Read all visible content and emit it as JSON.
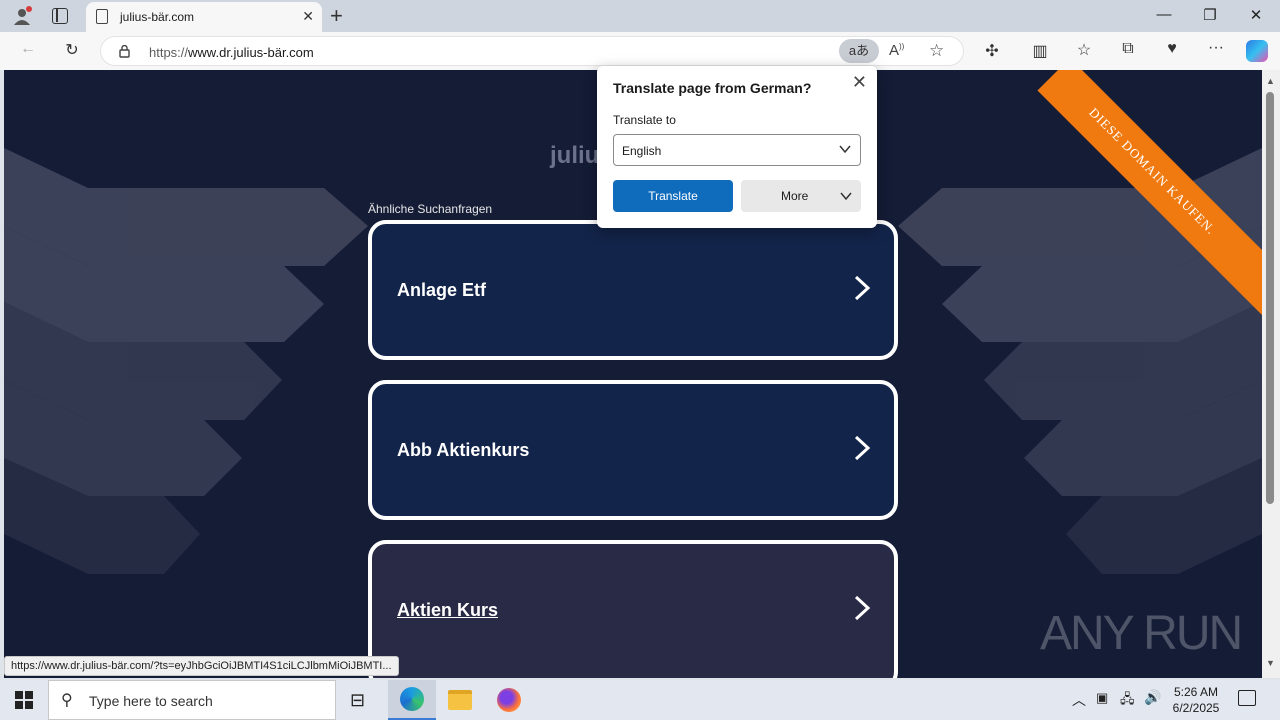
{
  "browser": {
    "tab_title": "julius-bär.com",
    "url_protocol": "https://",
    "url_rest": "www.dr.julius-bär.com",
    "translate_icon_label": "aあ"
  },
  "page": {
    "domain_title_partial": "juliu",
    "related_label": "Ähnliche Suchanfragen",
    "ribbon_text": "DIESE DOMAIN KAUFEN.",
    "cards": [
      {
        "label": "Anlage Etf",
        "bg": "#13244a"
      },
      {
        "label": "Abb Aktienkurs",
        "bg": "#13244a"
      },
      {
        "label": "Aktien Kurs",
        "bg": "#292a45"
      }
    ],
    "watermark": "ANY RUN",
    "accent_orange": "#f07a10"
  },
  "translate_popup": {
    "title": "Translate page from German?",
    "translate_to_label": "Translate to",
    "selected_language": "English",
    "translate_button": "Translate",
    "more_button": "More"
  },
  "status_bar": {
    "link": "https://www.dr.julius-bär.com/?ts=eyJhbGciOiJBMTI4S1ciLCJlbmMiOiJBMTI..."
  },
  "taskbar": {
    "search_placeholder": "Type here to search",
    "time": "5:26 AM",
    "date": "6/2/2025"
  }
}
